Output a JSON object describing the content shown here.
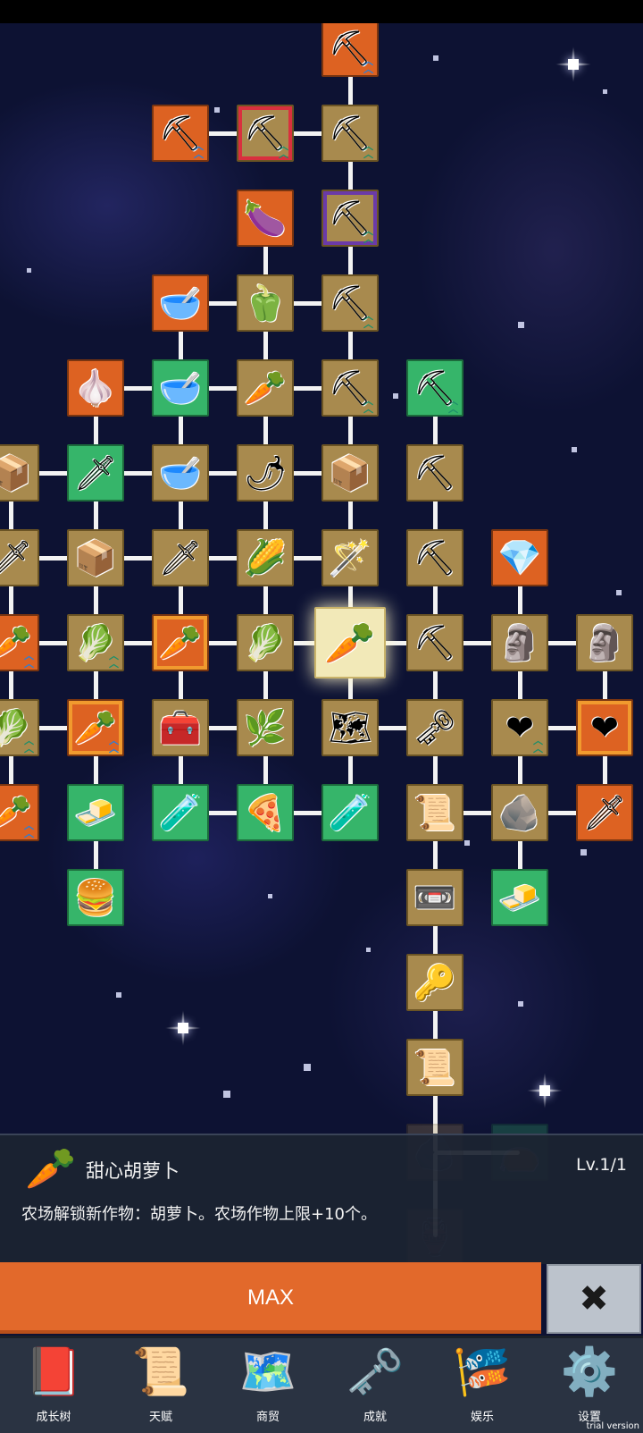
{
  "detail": {
    "icon": "carrot-icon",
    "name": "甜心胡萝卜",
    "level": "Lv.1/1",
    "description": "农场解锁新作物：胡萝卜。农场作物上限+10个。"
  },
  "actions": {
    "max_label": "MAX",
    "close_icon": "close-x-icon"
  },
  "bottom_nav": [
    {
      "label": "成长树",
      "icon": "book-icon"
    },
    {
      "label": "天赋",
      "icon": "scroll-icon"
    },
    {
      "label": "商贸",
      "icon": "map-icon"
    },
    {
      "label": "成就",
      "icon": "gold-key-icon"
    },
    {
      "label": "娱乐",
      "icon": "banner-icon"
    },
    {
      "label": "设置",
      "icon": "gear-icon"
    }
  ],
  "watermark": "trial version",
  "tree_nodes": [
    {
      "id": "n1",
      "icon": "shovel",
      "bg": "orange",
      "up": true
    },
    {
      "id": "n2",
      "icon": "shovel",
      "bg": "orange",
      "up": true
    },
    {
      "id": "n3",
      "icon": "shovel",
      "bg": "gold",
      "frame": "red",
      "up": true
    },
    {
      "id": "n4",
      "icon": "shovel",
      "bg": "gold",
      "up": true
    },
    {
      "id": "n5",
      "icon": "eggplant",
      "bg": "orange"
    },
    {
      "id": "n6",
      "icon": "shovel",
      "bg": "gold",
      "frame": "purple",
      "up": true
    },
    {
      "id": "n7",
      "icon": "bowl",
      "bg": "orange"
    },
    {
      "id": "n8",
      "icon": "pepper",
      "bg": "gold"
    },
    {
      "id": "n9",
      "icon": "shovel",
      "bg": "gold",
      "up": true
    },
    {
      "id": "n10",
      "icon": "garlic",
      "bg": "orange"
    },
    {
      "id": "n11",
      "icon": "bowl",
      "bg": "green"
    },
    {
      "id": "n12",
      "icon": "radish",
      "bg": "gold"
    },
    {
      "id": "n13",
      "icon": "shovel",
      "bg": "gold",
      "up": true
    },
    {
      "id": "n14",
      "icon": "pickaxe",
      "bg": "green",
      "up": true
    },
    {
      "id": "n15",
      "icon": "crate",
      "bg": "gold"
    },
    {
      "id": "n16",
      "icon": "sword",
      "bg": "green"
    },
    {
      "id": "n17",
      "icon": "bowl",
      "bg": "gold"
    },
    {
      "id": "n18",
      "icon": "chili",
      "bg": "gold"
    },
    {
      "id": "n19",
      "icon": "crate",
      "bg": "gold"
    },
    {
      "id": "n20",
      "icon": "pickaxe",
      "bg": "gold"
    },
    {
      "id": "n21",
      "icon": "sword",
      "bg": "gold"
    },
    {
      "id": "n22",
      "icon": "crate",
      "bg": "gold"
    },
    {
      "id": "n23",
      "icon": "sword",
      "bg": "gold"
    },
    {
      "id": "n24",
      "icon": "corn",
      "bg": "gold"
    },
    {
      "id": "n25",
      "icon": "staff",
      "bg": "gold"
    },
    {
      "id": "n26",
      "icon": "pickaxe",
      "bg": "gold"
    },
    {
      "id": "n27",
      "icon": "crystal",
      "bg": "orange"
    },
    {
      "id": "n28",
      "icon": "carrot",
      "bg": "orange",
      "up": true
    },
    {
      "id": "n29",
      "icon": "cabbage",
      "bg": "gold",
      "up": true
    },
    {
      "id": "n30",
      "icon": "carrot",
      "bg": "orange",
      "frame": "orange"
    },
    {
      "id": "n31",
      "icon": "cabbage",
      "bg": "gold"
    },
    {
      "id": "n32",
      "icon": "carrot",
      "bg": "gold",
      "selected": true
    },
    {
      "id": "n33",
      "icon": "pickaxe",
      "bg": "gold"
    },
    {
      "id": "n34",
      "icon": "statue",
      "bg": "gold"
    },
    {
      "id": "n35",
      "icon": "statue",
      "bg": "gold"
    },
    {
      "id": "n36",
      "icon": "cabbage",
      "bg": "gold",
      "up": true
    },
    {
      "id": "n37",
      "icon": "carrot",
      "bg": "orange",
      "frame": "orange",
      "up": true
    },
    {
      "id": "n38",
      "icon": "chest",
      "bg": "gold"
    },
    {
      "id": "n39",
      "icon": "leek",
      "bg": "gold"
    },
    {
      "id": "n40",
      "icon": "map",
      "bg": "gold"
    },
    {
      "id": "n41",
      "icon": "gold-key",
      "bg": "gold"
    },
    {
      "id": "n42",
      "icon": "heart",
      "bg": "gold",
      "up": true
    },
    {
      "id": "n43",
      "icon": "heart",
      "bg": "orange",
      "frame": "orange"
    },
    {
      "id": "n44",
      "icon": "carrot",
      "bg": "orange",
      "up": true
    },
    {
      "id": "n45",
      "icon": "gold-bar",
      "bg": "green"
    },
    {
      "id": "n46",
      "icon": "potion",
      "bg": "green"
    },
    {
      "id": "n47",
      "icon": "pizza",
      "bg": "green"
    },
    {
      "id": "n48",
      "icon": "potion",
      "bg": "green"
    },
    {
      "id": "n49",
      "icon": "scroll",
      "bg": "gold"
    },
    {
      "id": "n50",
      "icon": "stone",
      "bg": "gold"
    },
    {
      "id": "n51",
      "icon": "sword",
      "bg": "orange"
    },
    {
      "id": "n52",
      "icon": "burger",
      "bg": "green"
    },
    {
      "id": "n53",
      "icon": "cassette",
      "bg": "gold"
    },
    {
      "id": "n54",
      "icon": "butter",
      "bg": "green"
    },
    {
      "id": "n55",
      "icon": "iron-key",
      "bg": "gold"
    },
    {
      "id": "n56",
      "icon": "scroll",
      "bg": "gold"
    },
    {
      "id": "n57",
      "icon": "rock",
      "bg": "gold",
      "faded": true
    },
    {
      "id": "n58",
      "icon": "seed-pouch",
      "bg": "green",
      "faded": true
    },
    {
      "id": "n59",
      "icon": "pot",
      "bg": "gold",
      "faded": true
    }
  ]
}
